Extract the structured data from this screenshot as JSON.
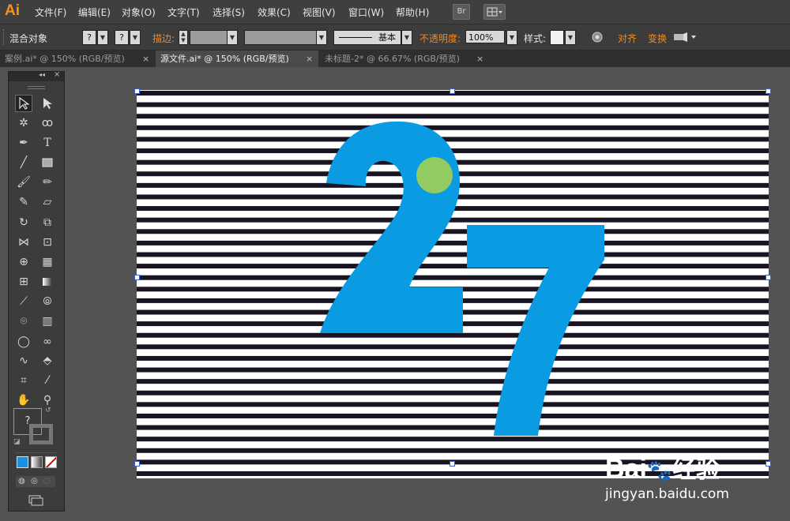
{
  "app": {
    "logo": "Ai"
  },
  "menubar": {
    "items": [
      "文件(F)",
      "编辑(E)",
      "对象(O)",
      "文字(T)",
      "选择(S)",
      "效果(C)",
      "视图(V)",
      "窗口(W)",
      "帮助(H)"
    ],
    "bridge_label": "Br"
  },
  "control_bar": {
    "object_type": "混合对象",
    "fill_label": "?",
    "stroke_label": "?",
    "stroke_text": "描边:",
    "brush_label": "基本",
    "opacity_label": "不透明度:",
    "opacity_value": "100%",
    "style_label": "样式:",
    "align_label": "对齐",
    "transform_label": "变换"
  },
  "tabs": [
    {
      "label": "案例.ai* @ 150% (RGB/预览)",
      "active": false
    },
    {
      "label": "源文件.ai* @ 150% (RGB/预览)",
      "active": true
    },
    {
      "label": "未标题-2* @ 66.67% (RGB/预览)",
      "active": false
    }
  ],
  "tab_close": "×",
  "toolpanel": {
    "collapse": "◂◂",
    "close": "×",
    "fill_query": "?"
  },
  "artwork": {
    "text": "27",
    "digit_color": "#0a9be2",
    "stripe_color": "#1a1322",
    "circle_color": "#9acd5a",
    "stripe_count": 34
  },
  "watermark": {
    "brand": "Bai",
    "brand2": "经验",
    "url": "jingyan.baidu.com"
  }
}
